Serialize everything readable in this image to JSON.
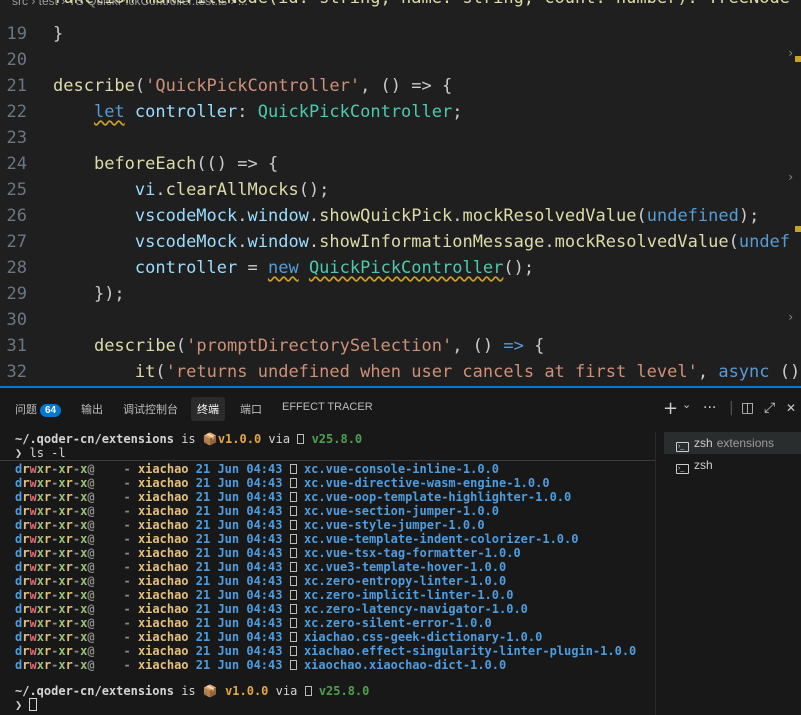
{
  "breadcrumb": "src › test › TS QuickPickController.test.ts › ...",
  "editor": {
    "partial_top": "function makeFileNode(id: string, name: string, count: number): TreeNode {",
    "lines": [
      {
        "n": "19"
      },
      {
        "n": "20"
      },
      {
        "n": "21"
      },
      {
        "n": "22"
      },
      {
        "n": "23"
      },
      {
        "n": "24"
      },
      {
        "n": "25"
      },
      {
        "n": "26"
      },
      {
        "n": "27"
      },
      {
        "n": "28"
      },
      {
        "n": "29"
      },
      {
        "n": "30"
      },
      {
        "n": "31"
      },
      {
        "n": "32"
      }
    ],
    "tokens": {
      "l19": "}",
      "l21_fn": "describe",
      "l21_str": "'QuickPickController'",
      "l21_rest": ", () => {",
      "l22_kw": "let",
      "l22_var": "controller",
      "l22_typ": "QuickPickController",
      "l24_fn": "beforeEach",
      "l24_rest": "(() => {",
      "l25_var": "vi",
      "l25_fn": "clearAllMocks",
      "l26_var1": "vscodeMock",
      "l26_var2": "window",
      "l26_fn1": "showQuickPick",
      "l26_fn2": "mockResolvedValue",
      "l26_kw": "undefined",
      "l27_var1": "vscodeMock",
      "l27_var2": "window",
      "l27_fn1": "showInformationMessage",
      "l27_fn2": "mockResolvedValue",
      "l27_kw": "undef",
      "l28_var": "controller",
      "l28_kw": "new",
      "l28_typ": "QuickPickController",
      "l29": "});",
      "l31_fn": "describe",
      "l31_str": "'promptDirectorySelection'",
      "l32_fn": "it",
      "l32_str": "'returns undefined when user cancels at first level'",
      "l32_kw": "async",
      "l32_rest": " ()"
    }
  },
  "panel": {
    "tabs": [
      {
        "label": "问题",
        "badge": "64"
      },
      {
        "label": "输出"
      },
      {
        "label": "调试控制台"
      },
      {
        "label": "终端",
        "active": true
      },
      {
        "label": "端口"
      },
      {
        "label": "EFFECT TRACER"
      }
    ],
    "tools": {
      "add": "+",
      "dropdown": "⌄",
      "more": "···",
      "split": "◫",
      "maximize": "⤢",
      "close": "✕"
    }
  },
  "terminal": {
    "prompt_cwd": "~/.qoder-cn/extensions",
    "prompt_is": "is",
    "prompt_pkg_icon": "📦",
    "prompt_version": "v1.0.0",
    "prompt_via": "via",
    "prompt_node": "v25.8.0",
    "command_arrow": "❯",
    "command": "ls -l",
    "entry_perm": "drwxr-xr-x@",
    "entry_dash": "-",
    "entry_owner": "xiachao",
    "entry_date": "21 Jun 04:43",
    "entries": [
      "xc.vue-console-inline-1.0.0",
      "xc.vue-directive-wasm-engine-1.0.0",
      "xc.vue-oop-template-highlighter-1.0.0",
      "xc.vue-section-jumper-1.0.0",
      "xc.vue-style-jumper-1.0.0",
      "xc.vue-template-indent-colorizer-1.0.0",
      "xc.vue-tsx-tag-formatter-1.0.0",
      "xc.vue3-template-hover-1.0.0",
      "xc.zero-entropy-linter-1.0.0",
      "xc.zero-implicit-linter-1.0.0",
      "xc.zero-latency-navigator-1.0.0",
      "xc.zero-silent-error-1.0.0",
      "xiachao.css-geek-dictionary-1.0.0",
      "xiachao.effect-singularity-linter-plugin-1.0.0",
      "xiaochao.xiaochao-dict-1.0.0"
    ]
  },
  "terminal_list": [
    {
      "label": "zsh",
      "desc": "extensions",
      "selected": true
    },
    {
      "label": "zsh",
      "desc": ""
    }
  ],
  "colors": {
    "accent": "#0078d4",
    "editor_bg": "#1f1f1f",
    "panel_bg": "#181818"
  }
}
